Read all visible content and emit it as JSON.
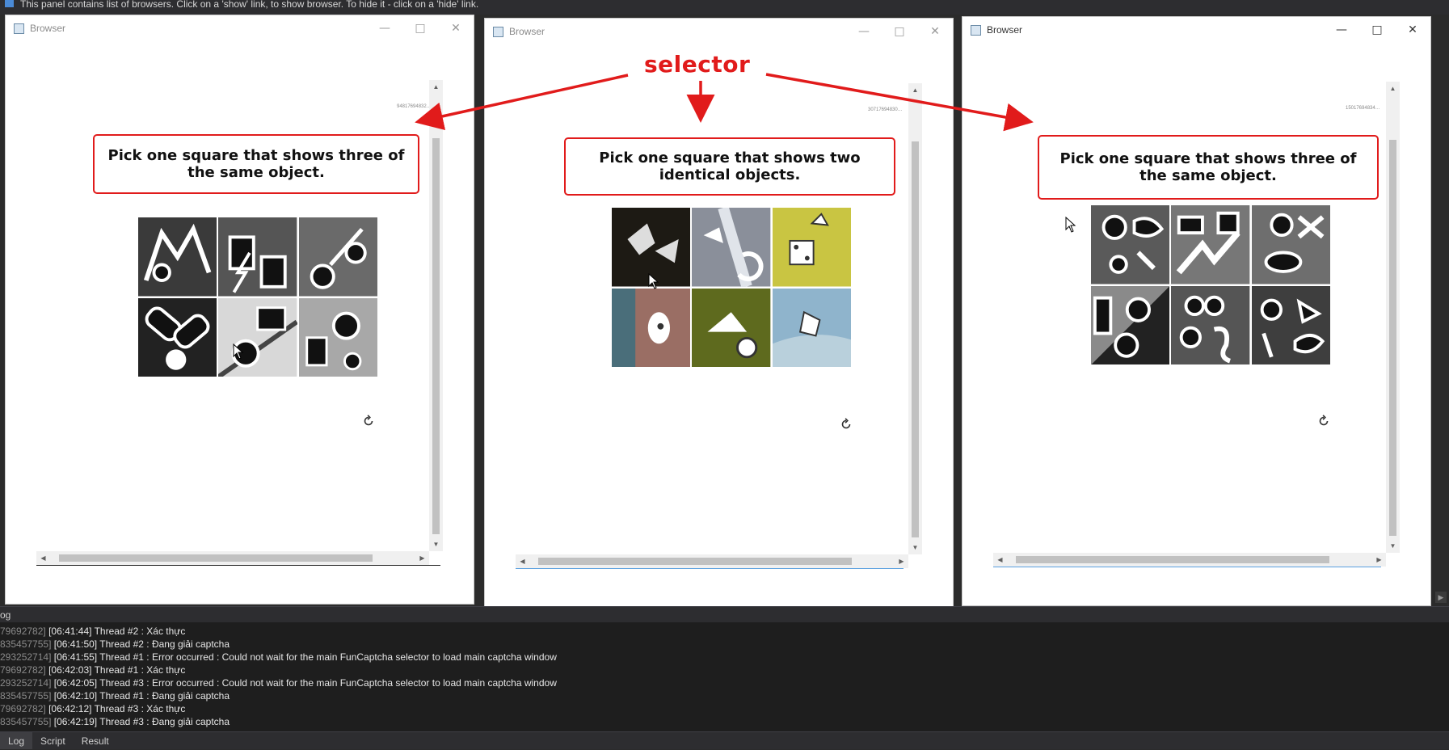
{
  "topbar": {
    "info_text": "This panel contains list of browsers. Click on a 'show' link, to show browser. To hide it - click on a 'hide' link."
  },
  "windows": [
    {
      "title": "Browser",
      "captcha_id": "94817694832…",
      "prompt": "Pick one square that shows three of the same object."
    },
    {
      "title": "Browser",
      "captcha_id": "30717694830…",
      "prompt": "Pick one square that shows two identical objects."
    },
    {
      "title": "Browser",
      "captcha_id": "15017694834…",
      "prompt": "Pick one square that shows three of the same object."
    }
  ],
  "window_controls": {
    "minimize": "—",
    "maximize": "□",
    "close": "✕"
  },
  "annotation": {
    "label": "selector",
    "color": "#e11b1b"
  },
  "log": {
    "header": "og",
    "lines": [
      {
        "pid": "79692782]",
        "text": " [06:41:44] Thread #2 : Xác thực"
      },
      {
        "pid": "835457755]",
        "text": " [06:41:50] Thread #2 : Đang giải captcha"
      },
      {
        "pid": "293252714]",
        "text": " [06:41:55] Thread #1 : Error occurred : Could not wait for the main FunCaptcha selector to load main captcha window"
      },
      {
        "pid": "79692782]",
        "text": " [06:42:03] Thread #1 : Xác thực"
      },
      {
        "pid": "293252714]",
        "text": " [06:42:05] Thread #3 : Error occurred : Could not wait for the main FunCaptcha selector to load main captcha window"
      },
      {
        "pid": "835457755]",
        "text": " [06:42:10] Thread #1 : Đang giải captcha"
      },
      {
        "pid": "79692782]",
        "text": " [06:42:12] Thread #3 : Xác thực"
      },
      {
        "pid": "835457755]",
        "text": " [06:42:19] Thread #3 : Đang giải captcha"
      }
    ]
  },
  "tabs": [
    "Log",
    "Script",
    "Result"
  ],
  "icons": {
    "window_icon": "app-window-icon",
    "reload": "reload-icon",
    "cursor": "mouse-cursor-icon",
    "info": "info-icon"
  }
}
